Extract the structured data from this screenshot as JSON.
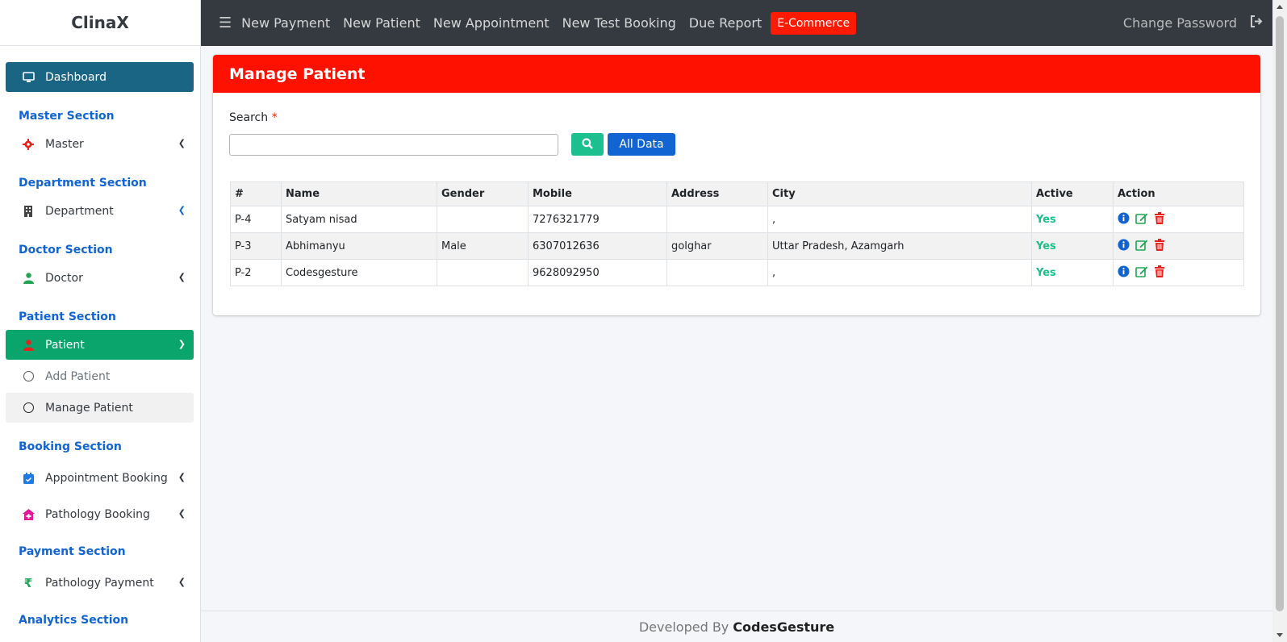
{
  "app": {
    "title": "ClinaX"
  },
  "topbar": {
    "links": [
      "New Payment",
      "New Patient",
      "New Appointment",
      "New Test Booking",
      "Due Report"
    ],
    "ecommerce": "E-Commerce",
    "change_password": "Change Password"
  },
  "sidebar": {
    "dashboard": "Dashboard",
    "master_section": "Master Section",
    "master": "Master",
    "department_section": "Department Section",
    "department": "Department",
    "doctor_section": "Doctor Section",
    "doctor": "Doctor",
    "patient_section": "Patient Section",
    "patient": "Patient",
    "add_patient": "Add Patient",
    "manage_patient": "Manage Patient",
    "booking_section": "Booking Section",
    "appointment_booking": "Appointment Booking",
    "pathology_booking": "Pathology Booking",
    "payment_section": "Payment Section",
    "pathology_payment": "Pathology Payment",
    "analytics_section": "Analytics Section"
  },
  "main": {
    "title": "Manage Patient",
    "search_label": "Search",
    "search_required": "*",
    "search_value": "",
    "all_data_label": "All Data",
    "table": {
      "headers": [
        "#",
        "Name",
        "Gender",
        "Mobile",
        "Address",
        "City",
        "Active",
        "Action"
      ],
      "rows": [
        {
          "id": "P-4",
          "name": "Satyam nisad",
          "gender": "",
          "mobile": "7276321779",
          "address": "",
          "city": ",",
          "active": "Yes"
        },
        {
          "id": "P-3",
          "name": "Abhimanyu",
          "gender": "Male",
          "mobile": "6307012636",
          "address": "golghar",
          "city": "Uttar Pradesh, Azamgarh",
          "active": "Yes"
        },
        {
          "id": "P-2",
          "name": "Codesgesture",
          "gender": "",
          "mobile": "9628092950",
          "address": "",
          "city": ",",
          "active": "Yes"
        }
      ]
    }
  },
  "footer": {
    "prefix": "Developed By",
    "brand": "CodesGesture"
  },
  "colors": {
    "dashboard_bg": "#1a6584",
    "patient_active_bg": "#0aa56c",
    "header_red": "#ff1100",
    "section_blue": "#1164d1",
    "active_green": "#17c28a",
    "topbar_bg": "#343a40"
  },
  "icons": {
    "dashboard": "monitor-icon",
    "master": "gear-icon",
    "department": "building-icon",
    "doctor": "doctor-icon",
    "patient": "user-icon",
    "appointment": "calendar-check-icon",
    "pathology_booking": "house-medical-icon",
    "pathology_payment": "rupee-icon",
    "menu": "hamburger-icon",
    "logout": "logout-icon",
    "search": "search-icon",
    "row_actions": [
      "info-icon",
      "edit-icon",
      "delete-icon"
    ]
  }
}
